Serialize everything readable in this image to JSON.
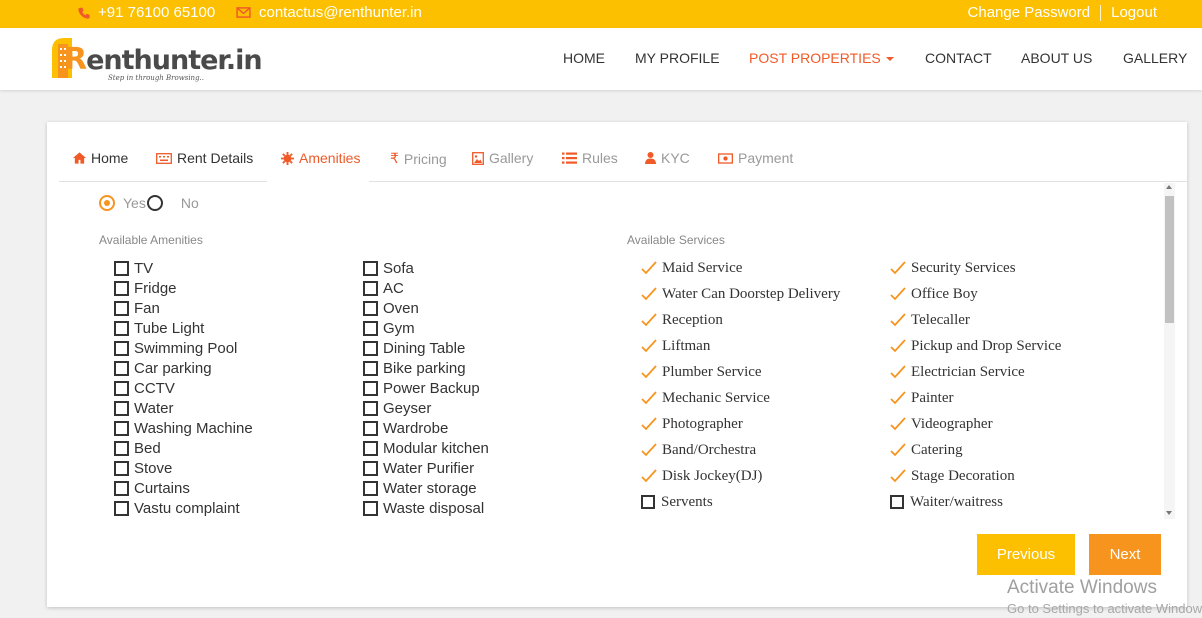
{
  "topbar": {
    "phone": "+91 76100 65100",
    "email": "contactus@renthunter.in",
    "change_password": "Change Password",
    "logout": "Logout"
  },
  "logo": {
    "brand": "enthunter.in",
    "brand_initial": "R",
    "tagline": "Step in through Browsing.."
  },
  "nav": {
    "home": "HOME",
    "my_profile": "MY PROFILE",
    "post_properties": "POST PROPERTIES",
    "contact": "CONTACT",
    "about_us": "ABOUT US",
    "gallery": "GALLERY"
  },
  "tabs": [
    {
      "label": "Home",
      "icon": "home-icon"
    },
    {
      "label": "Rent Details",
      "icon": "keyboard-icon"
    },
    {
      "label": "Amenities",
      "icon": "gear-icon"
    },
    {
      "label": "Pricing",
      "icon": "rupee-icon"
    },
    {
      "label": "Gallery",
      "icon": "image-icon"
    },
    {
      "label": "Rules",
      "icon": "list-icon"
    },
    {
      "label": "KYC",
      "icon": "user-icon"
    },
    {
      "label": "Payment",
      "icon": "money-icon"
    }
  ],
  "radio": {
    "yes": "Yes",
    "no": "No",
    "selected": "Yes"
  },
  "amenities": {
    "label": "Available Amenities",
    "col1": [
      "TV",
      "Fridge",
      "Fan",
      "Tube Light",
      "Swimming Pool",
      "Car parking",
      "CCTV",
      "Water",
      "Washing Machine",
      "Bed",
      "Stove",
      "Curtains",
      "Vastu complaint"
    ],
    "col2": [
      "Sofa",
      "AC",
      "Oven",
      "Gym",
      "Dining Table",
      "Bike parking",
      "Power Backup",
      "Geyser",
      "Wardrobe",
      "Modular kitchen",
      "Water Purifier",
      "Water storage",
      "Waste disposal"
    ]
  },
  "services": {
    "label": "Available Services",
    "col1": [
      {
        "name": "Maid Service",
        "checked": true
      },
      {
        "name": "Water Can Doorstep Delivery",
        "checked": true
      },
      {
        "name": "Reception",
        "checked": true
      },
      {
        "name": "Liftman",
        "checked": true
      },
      {
        "name": "Plumber Service",
        "checked": true
      },
      {
        "name": "Mechanic Service",
        "checked": true
      },
      {
        "name": "Photographer",
        "checked": true
      },
      {
        "name": "Band/Orchestra",
        "checked": true
      },
      {
        "name": "Disk Jockey(DJ)",
        "checked": true
      },
      {
        "name": "Servents",
        "checked": false
      }
    ],
    "col2": [
      {
        "name": "Security Services",
        "checked": true
      },
      {
        "name": "Office Boy",
        "checked": true
      },
      {
        "name": "Telecaller",
        "checked": true
      },
      {
        "name": "Pickup and Drop Service",
        "checked": true
      },
      {
        "name": "Electrician Service",
        "checked": true
      },
      {
        "name": "Painter",
        "checked": true
      },
      {
        "name": "Videographer",
        "checked": true
      },
      {
        "name": "Catering",
        "checked": true
      },
      {
        "name": "Stage Decoration",
        "checked": true
      },
      {
        "name": "Waiter/waitress",
        "checked": false
      }
    ]
  },
  "buttons": {
    "previous": "Previous",
    "next": "Next"
  },
  "watermark": {
    "title": "Activate Windows",
    "subtitle": "Go to Settings to activate Windows."
  },
  "colors": {
    "topbar": "#fdc000",
    "accent": "#f05a28",
    "check": "#f7941d"
  }
}
